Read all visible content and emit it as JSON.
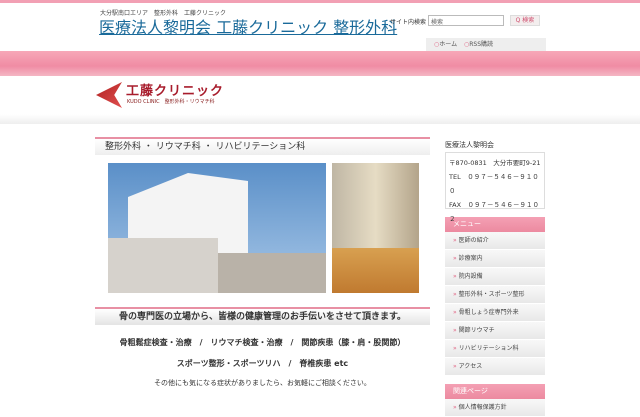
{
  "header": {
    "subtitle": "大分駅南口エリア　整形外科　工藤クリニック",
    "title": "医療法人黎明会 工藤クリニック 整形外科",
    "search_label": "サイト内検索",
    "search_value": "検索",
    "search_button": "Q 検索",
    "nav": [
      "ホーム",
      "RSS購読"
    ]
  },
  "logo": {
    "name": "工藤クリニック",
    "english": "KUDO CLINIC　整形外科・リウマチ科"
  },
  "main": {
    "section_title": "整形外科 ・ リウマチ科 ・ リハビリテーション科",
    "message": "骨の専門医の立場から、皆様の健康管理のお手伝いをさせて頂きます。",
    "line1": "骨粗鬆症検査・治療　/　リウマチ検査・治療　/　関節疾患（膝・肩・股関節）",
    "line2": "スポーツ整形・スポーツリハ　/　脊椎疾患 etc",
    "line3": "その他にも気になる症状がありましたら、お気軽にご相談ください。"
  },
  "sidebar": {
    "org": "医療法人黎明会",
    "address": "〒870-0831　大分市要町9-21",
    "tel": "TEL　０９７－５４６－９１００",
    "fax": "FAX　０９７－５４６－９１０２",
    "menu_title": "メニュー",
    "menu": [
      "医師の紹介",
      "診療案内",
      "院内設備",
      "整形外科・スポーツ整形",
      "骨粗しょう症専門外来",
      "関節リウマチ",
      "リハビリテーション科",
      "アクセス"
    ],
    "related_title": "関連ページ",
    "related": [
      "個人情報保護方針"
    ]
  }
}
